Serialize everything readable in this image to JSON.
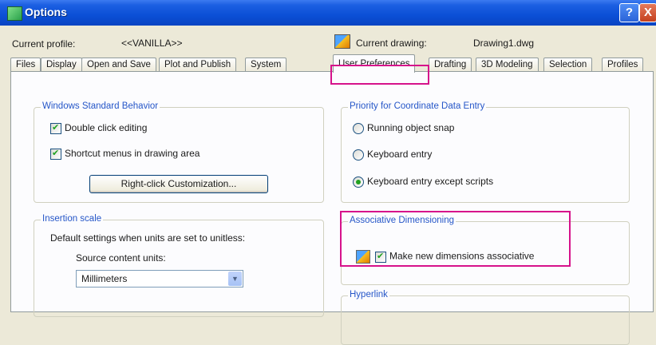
{
  "window": {
    "title": "Options",
    "help_symbol": "?",
    "close_symbol": "X"
  },
  "profile": {
    "label": "Current profile:",
    "value": "<<VANILLA>>",
    "drawing_label": "Current drawing:",
    "drawing_value": "Drawing1.dwg"
  },
  "tabs": [
    {
      "label": "Files",
      "active": false
    },
    {
      "label": "Display",
      "active": false
    },
    {
      "label": "Open and Save",
      "active": false
    },
    {
      "label": "Plot and Publish",
      "active": false
    },
    {
      "label": "System",
      "active": false
    },
    {
      "label": "User Preferences",
      "active": true
    },
    {
      "label": "Drafting",
      "active": false
    },
    {
      "label": "3D Modeling",
      "active": false
    },
    {
      "label": "Selection",
      "active": false
    },
    {
      "label": "Profiles",
      "active": false
    }
  ],
  "windows_behavior": {
    "legend": "Windows Standard Behavior",
    "double_click": "Double click editing",
    "shortcut_menus": "Shortcut menus in drawing area",
    "customization_button": "Right-click Customization..."
  },
  "priority": {
    "legend": "Priority for Coordinate Data Entry",
    "options": [
      "Running object snap",
      "Keyboard entry",
      "Keyboard entry except scripts"
    ],
    "selected_index": 2
  },
  "insertion": {
    "legend": "Insertion scale",
    "description": "Default settings when units are set to unitless:",
    "source_label": "Source content units:",
    "source_value": "Millimeters"
  },
  "associative": {
    "legend": "Associative Dimensioning",
    "checkbox_label": "Make new dimensions associative"
  },
  "hyperlink": {
    "legend": "Hyperlink"
  },
  "colors": {
    "highlight": "#d6128b",
    "legend_text": "#2556c8"
  }
}
